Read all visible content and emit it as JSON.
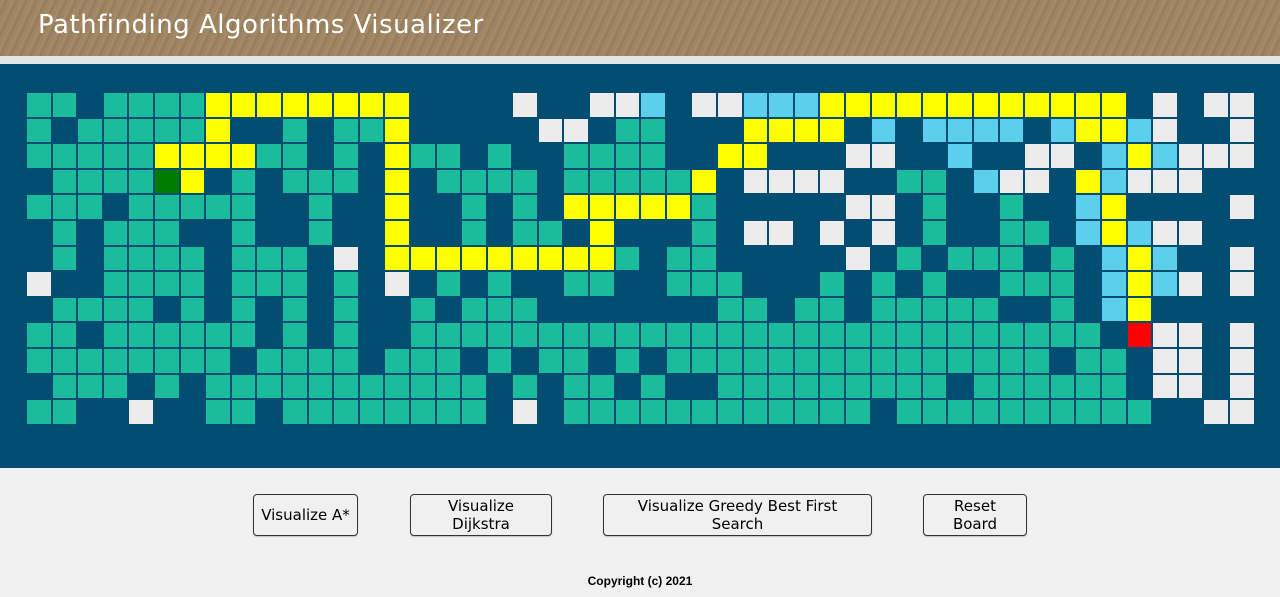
{
  "header": {
    "title": "Pathfinding Algorithms Visualizer"
  },
  "controls": {
    "astar_label": "Visualize A*",
    "dijkstra_label": "Visualize Dijkstra",
    "greedy_label": "Visualize Greedy Best First Search",
    "reset_label": "Reset Board"
  },
  "footer": {
    "copyright": "Copyright (c) 2021"
  },
  "colors": {
    "wall": "#034d72",
    "open": "#1abc9c",
    "path": "#ffff00",
    "frontier": "#5bcfeb",
    "visited": "#ececec",
    "start": "#007d00",
    "target": "#ff0000"
  },
  "grid": {
    "rows": 13,
    "cols": 48,
    "legend": {
      "W": "wall",
      "O": "open",
      "P": "path",
      "C": "frontier",
      "E": "visited",
      "S": "start",
      "T": "target"
    },
    "cells": [
      "OOWOOOOPPPPPPPPWWWWEWWEECWEECCCPPPPPPPPPPPPWEWEE",
      "OWOOOOOPWWOWOOPWWWWWEEWOOWWWPPPPWCWCCCCWCPPCEWWE",
      "OOOOOPPPPOOWOWPOOWOWWOOOOWWPPWWWEEWWCWWEEWCPCEEE",
      "WOOOOSPWOWOOOWPWOOOOWOOOOOPWEEEEWWOOWCEEWPCEEE",
      "OOOWOOOOOWWOWWPWWOWOWPPPPPOWWWWWEEWOWWOWWCPWWWWE",
      "WOWOOOWWOWWOWWPWWOWOOWPWWWOWEEWEWEWOWWOOWCPCEEWW",
      "WOWOOOOWOOOWEWPPPPPPPPPOWOOWWWWWEWOWOOOWOWCPCWWE",
      "EWWOOOOWOOOWOWEWOWOWWOOWWOOOWWWOWOWOWWOOOWCPCEWE",
      "WOOOOWOWOWOWOWWOWOOOWWWWWWWOOWOOWOOOOOWWOWCPWWWW",
      "OOWOOOOOOWOWOWWOOOOOOOOOOOOOOOOOOOOOOOOOOOWTEEWE",
      "OOOOOOOOWOOOOWOOOWOWOOWOWOOOOOOOOOOOOOOOWOOWEEWE",
      "WOOOWOWOOOOOOOOOOOWOWOOWOWWOOOOOOOOOWOOOOOOWEEWE",
      "OOWWEWWOOWOOOOOOOOWEWOOOOOOOOOOOOWOOOOOOOOOOWWEE"
    ]
  }
}
